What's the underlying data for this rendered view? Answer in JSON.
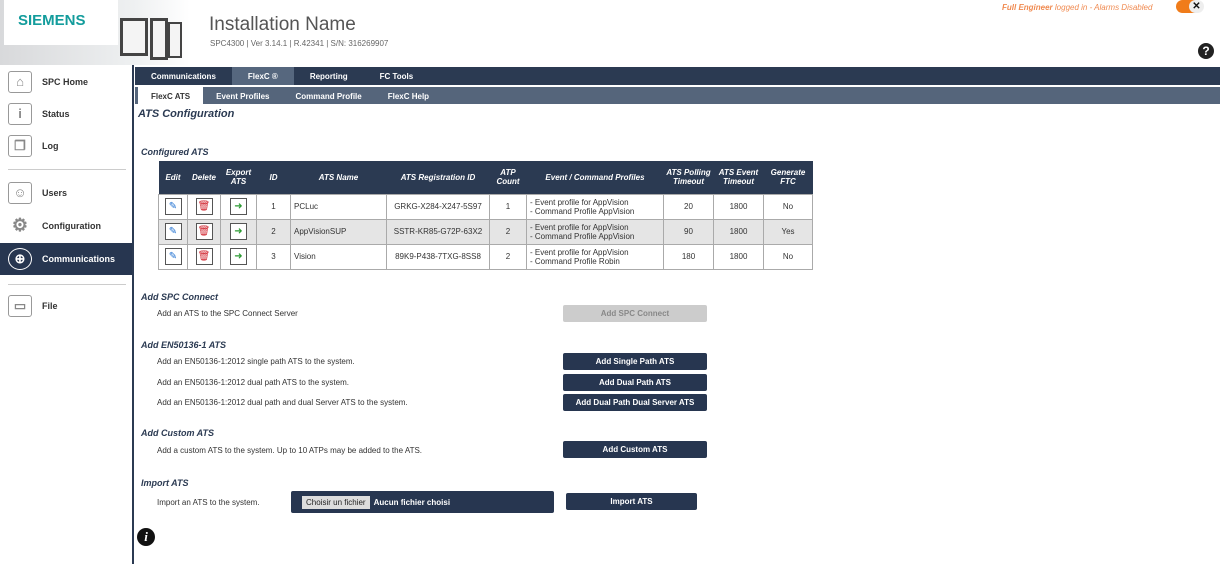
{
  "header": {
    "logo": "SIEMENS",
    "title": "Installation Name",
    "subtitle": "SPC4300  |  Ver 3.14.1  |  R.42341  |  S/N: 316269907",
    "user_role": "Full Engineer",
    "login_status": " logged in - Alarms Disabled",
    "toggle_icon": "✕"
  },
  "sidebar": {
    "items": [
      {
        "label": "SPC Home",
        "icon": "home-icon"
      },
      {
        "label": "Status",
        "icon": "info-icon"
      },
      {
        "label": "Log",
        "icon": "log-icon"
      },
      {
        "label": "Users",
        "icon": "user-icon"
      },
      {
        "label": "Configuration",
        "icon": "gear-icon"
      },
      {
        "label": "Communications",
        "icon": "globe-icon",
        "active": true
      },
      {
        "label": "File",
        "icon": "folder-icon"
      }
    ]
  },
  "tabs": [
    "Communications",
    "FlexC ®",
    "Reporting",
    "FC Tools"
  ],
  "subtabs": [
    "FlexC ATS",
    "Event Profiles",
    "Command Profile",
    "FlexC Help"
  ],
  "page_title": "ATS Configuration",
  "configured": {
    "title": "Configured ATS",
    "columns": [
      "Edit",
      "Delete",
      "Export ATS",
      "ID",
      "ATS Name",
      "ATS Registration ID",
      "ATP Count",
      "Event / Command Profiles",
      "ATS Polling Timeout",
      "ATS Event Timeout",
      "Generate FTC"
    ],
    "rows": [
      {
        "id": "1",
        "name": "PCLuc",
        "reg": "GRKG-X284-X247-5S97",
        "atp": "1",
        "p1": "- Event profile for AppVision",
        "p2": "- Command Profile AppVision",
        "poll": "20",
        "event": "1800",
        "ftc": "No"
      },
      {
        "id": "2",
        "name": "AppVisionSUP",
        "reg": "SSTR-KR85-G72P-63X2",
        "atp": "2",
        "p1": "- Event profile for AppVision",
        "p2": "- Command Profile AppVision",
        "poll": "90",
        "event": "1800",
        "ftc": "Yes"
      },
      {
        "id": "3",
        "name": "Vision",
        "reg": "89K9-P438-7TXG-8SS8",
        "atp": "2",
        "p1": "- Event profile for AppVision",
        "p2": "- Command Profile Robin",
        "poll": "180",
        "event": "1800",
        "ftc": "No"
      }
    ]
  },
  "spc_connect": {
    "title": "Add SPC Connect",
    "desc": "Add an ATS to the SPC Connect Server",
    "button": "Add SPC Connect"
  },
  "en50136": {
    "title": "Add EN50136-1 ATS",
    "single_desc": "Add an EN50136-1:2012 single path ATS to the system.",
    "single_btn": "Add Single Path ATS",
    "dual_desc": "Add an EN50136-1:2012 dual path ATS to the system.",
    "dual_btn": "Add Dual Path ATS",
    "dualserver_desc": "Add an EN50136-1:2012 dual path and dual Server ATS to the system.",
    "dualserver_btn": "Add Dual Path Dual Server ATS"
  },
  "custom": {
    "title": "Add Custom ATS",
    "desc": "Add a custom ATS to the system. Up to 10 ATPs may be added to the ATS.",
    "button": "Add Custom ATS"
  },
  "import": {
    "title": "Import ATS",
    "desc": "Import an ATS to the system.",
    "choose": "Choisir un fichier",
    "no_file": "Aucun fichier choisi",
    "button": "Import ATS"
  }
}
